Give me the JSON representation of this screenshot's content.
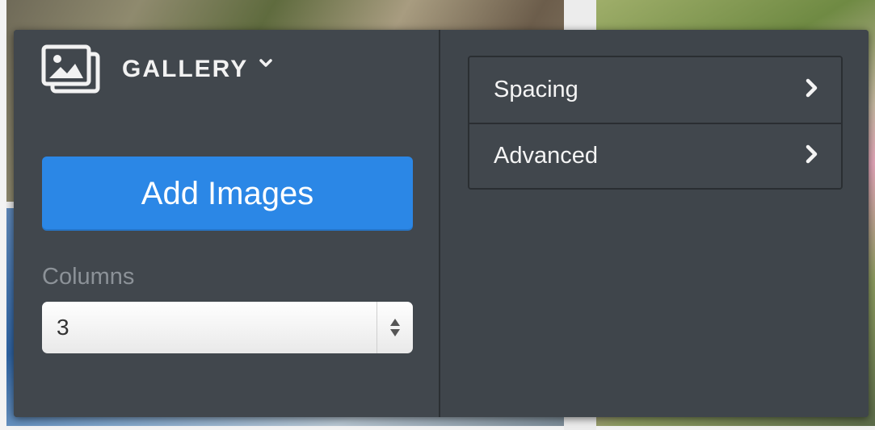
{
  "header": {
    "title": "GALLERY",
    "icon": "gallery-icon",
    "dropdown_icon": "chevron-down-icon"
  },
  "actions": {
    "add_images_label": "Add Images"
  },
  "columns": {
    "label": "Columns",
    "value": "3"
  },
  "menu": {
    "items": [
      {
        "label": "Spacing",
        "icon": "chevron-right-icon"
      },
      {
        "label": "Advanced",
        "icon": "chevron-right-icon"
      }
    ]
  },
  "colors": {
    "panel_background": "#3f454b",
    "accent_button": "#2b87e6",
    "text_primary": "#f2f2f2",
    "text_muted": "#8c9298"
  }
}
